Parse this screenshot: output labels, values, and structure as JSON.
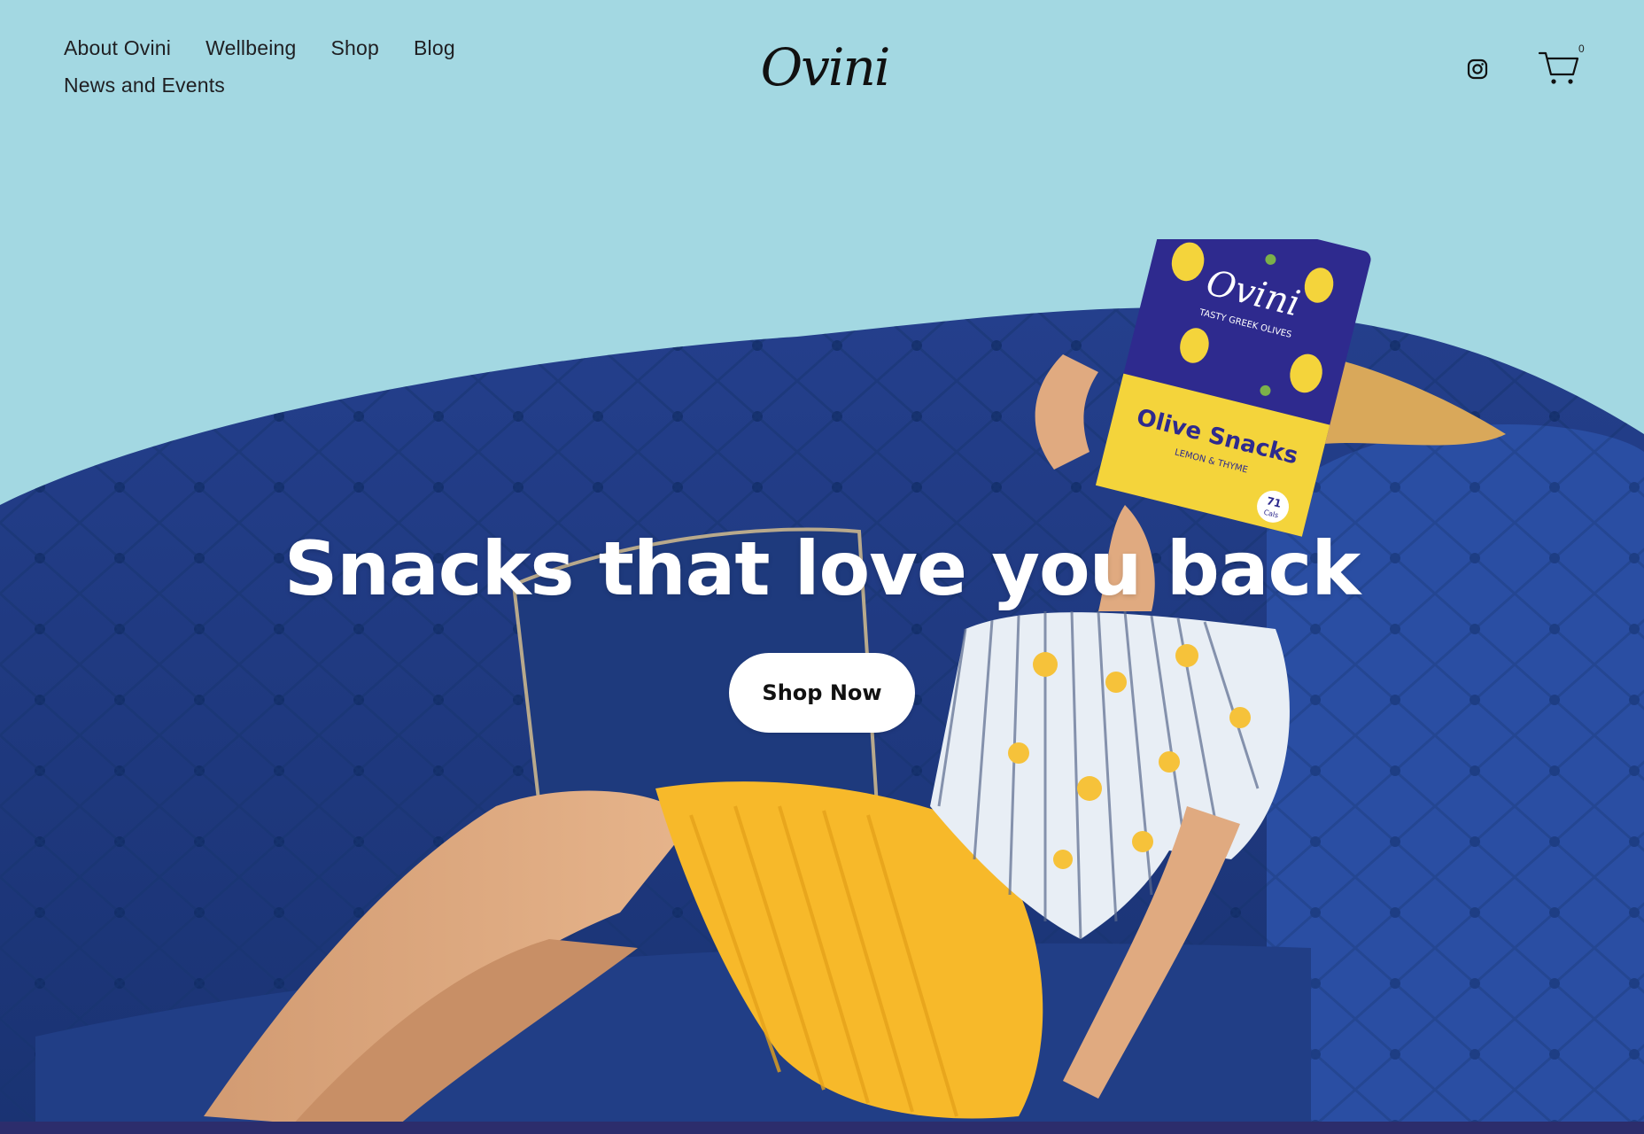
{
  "nav": {
    "items": [
      {
        "label": "About Ovini"
      },
      {
        "label": "Wellbeing"
      },
      {
        "label": "Shop"
      },
      {
        "label": "Blog"
      },
      {
        "label": "News and Events"
      }
    ]
  },
  "brand": {
    "logo_text": "Ovini"
  },
  "header": {
    "instagram_icon": "instagram-icon",
    "cart_icon": "cart-icon",
    "cart_count": "0"
  },
  "hero": {
    "headline": "Snacks that love you back",
    "cta_label": "Shop Now",
    "product": {
      "brand": "Ovini",
      "tagline": "TASTY GREEK OLIVES",
      "name": "Olive Snacks",
      "flavour": "LEMON & THYME",
      "calories": "71",
      "calories_unit": "Cals"
    }
  },
  "colors": {
    "background": "#a3d8e2",
    "sofa": "#1f3f8a",
    "bag_purple": "#2e2a8e",
    "bag_yellow": "#f4d43b",
    "skirt": "#f7b92a",
    "bottom_bar": "#2c2d6c"
  }
}
